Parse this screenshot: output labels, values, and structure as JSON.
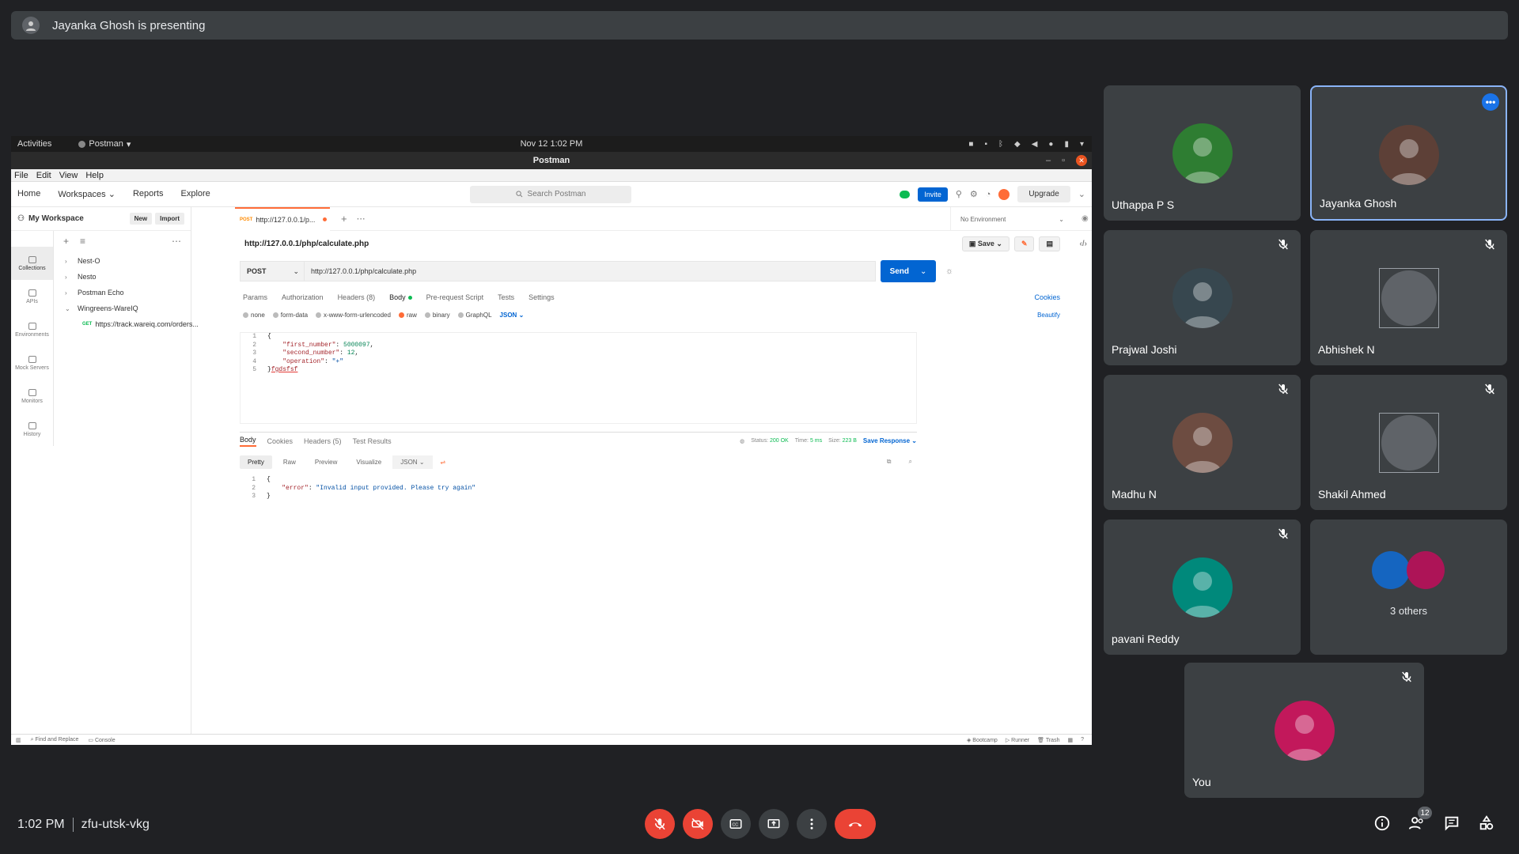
{
  "presenting": {
    "text": "Jayanka Ghosh is presenting"
  },
  "shared_screen": {
    "gnome": {
      "activities": "Activities",
      "app_name": "Postman",
      "clock": "Nov 12  1:02 PM"
    },
    "window_title": "Postman",
    "menu": [
      "File",
      "Edit",
      "View",
      "Help"
    ],
    "header": {
      "nav": [
        "Home",
        "Workspaces",
        "Reports",
        "Explore"
      ],
      "search_placeholder": "Search Postman",
      "invite": "Invite",
      "upgrade": "Upgrade"
    },
    "workspace": {
      "name": "My Workspace",
      "new": "New",
      "import": "Import"
    },
    "rail": [
      "Collections",
      "APIs",
      "Environments",
      "Mock Servers",
      "Monitors",
      "History"
    ],
    "collections": [
      "Nest-O",
      "Nesto",
      "Postman Echo",
      "Wingreens-WareIQ"
    ],
    "sub_request": {
      "method": "GET",
      "url": "https://track.wareiq.com/orders..."
    },
    "tab": {
      "method": "POST",
      "label": "http://127.0.0.1/p..."
    },
    "environment": "No Environment",
    "request": {
      "title": "http://127.0.0.1/php/calculate.php",
      "save": "Save",
      "method": "POST",
      "url": "http://127.0.0.1/php/calculate.php",
      "send": "Send",
      "tabs": [
        "Params",
        "Authorization",
        "Headers (8)",
        "Body",
        "Pre-request Script",
        "Tests",
        "Settings"
      ],
      "cookies": "Cookies",
      "body_types": [
        "none",
        "form-data",
        "x-www-form-urlencoded",
        "raw",
        "binary",
        "GraphQL"
      ],
      "format": "JSON",
      "beautify": "Beautify",
      "code": [
        {
          "ln": "1",
          "parts": [
            {
              "t": "{",
              "c": ""
            }
          ]
        },
        {
          "ln": "2",
          "parts": [
            {
              "t": "    \"first_number\"",
              "c": "k"
            },
            {
              "t": ": ",
              "c": ""
            },
            {
              "t": "5000097",
              "c": "n"
            },
            {
              "t": ",",
              "c": ""
            }
          ]
        },
        {
          "ln": "3",
          "parts": [
            {
              "t": "    \"second_number\"",
              "c": "k"
            },
            {
              "t": ": ",
              "c": ""
            },
            {
              "t": "12",
              "c": "n"
            },
            {
              "t": ",",
              "c": ""
            }
          ]
        },
        {
          "ln": "4",
          "parts": [
            {
              "t": "    \"operation\"",
              "c": "k"
            },
            {
              "t": ": ",
              "c": ""
            },
            {
              "t": "\"+\"",
              "c": "s"
            }
          ]
        },
        {
          "ln": "5",
          "parts": [
            {
              "t": "}",
              "c": ""
            },
            {
              "t": "fgdsfsf",
              "c": "err"
            }
          ]
        }
      ]
    },
    "response": {
      "tabs": [
        "Body",
        "Cookies",
        "Headers (5)",
        "Test Results"
      ],
      "status_label": "Status:",
      "status": "200 OK",
      "time_label": "Time:",
      "time": "5 ms",
      "size_label": "Size:",
      "size": "223 B",
      "save_response": "Save Response",
      "views": [
        "Pretty",
        "Raw",
        "Preview",
        "Visualize"
      ],
      "format": "JSON",
      "code": [
        {
          "ln": "1",
          "parts": [
            {
              "t": "{",
              "c": ""
            }
          ]
        },
        {
          "ln": "2",
          "parts": [
            {
              "t": "    \"error\"",
              "c": "k"
            },
            {
              "t": ": ",
              "c": ""
            },
            {
              "t": "\"Invalid input provided. Please try again\"",
              "c": "s"
            }
          ]
        },
        {
          "ln": "3",
          "parts": [
            {
              "t": "}",
              "c": ""
            }
          ]
        }
      ]
    },
    "status_bar": {
      "find": "Find and Replace",
      "console": "Console",
      "bootcamp": "Bootcamp",
      "runner": "Runner",
      "trash": "Trash"
    }
  },
  "participants": [
    {
      "name": "Uthappa P S",
      "muted": false,
      "avatar_color": "#2e7d32"
    },
    {
      "name": "Jayanka Ghosh",
      "muted": false,
      "active": true,
      "avatar_color": "#5d4037"
    },
    {
      "name": "Prajwal Joshi",
      "muted": true,
      "avatar_color": "#37474f"
    },
    {
      "name": "Abhishek N",
      "muted": true,
      "broken": true
    },
    {
      "name": "Madhu N",
      "muted": true,
      "avatar_color": "#6d4c41"
    },
    {
      "name": "Shakil Ahmed",
      "muted": true,
      "broken": true
    },
    {
      "name": "pavani Reddy",
      "muted": true,
      "avatar_color": "#00897b"
    },
    {
      "name": "",
      "others": "3 others"
    },
    {
      "name": "You",
      "muted": true,
      "avatar_color": "#c2185b"
    }
  ],
  "bottom": {
    "time": "1:02 PM",
    "meeting_code": "zfu-utsk-vkg",
    "people_count": "12"
  },
  "colors": {
    "accent": "#1a73e8",
    "danger": "#ea4335",
    "postman_orange": "#ff6c37",
    "postman_blue": "#0265d2"
  }
}
